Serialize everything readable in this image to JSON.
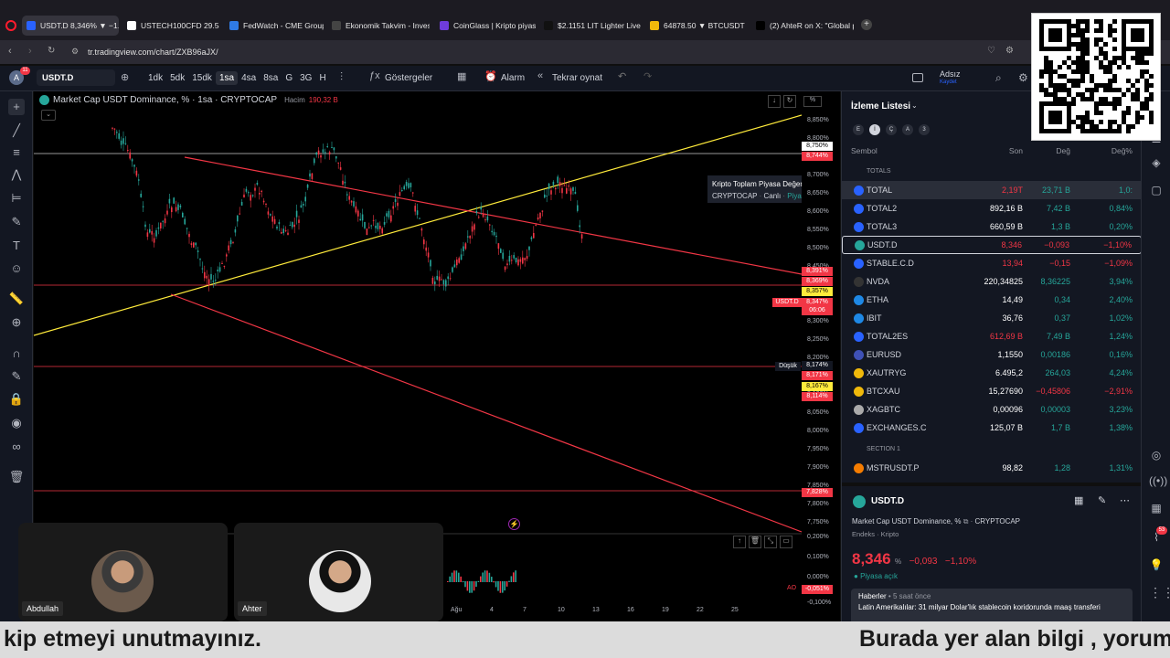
{
  "tabs": [
    {
      "label": "USDT.D 8,346% ▼ −1.1%",
      "active": true,
      "color": "#2962ff"
    },
    {
      "label": "USTECH100CFD 29.584,8",
      "color": "#fff"
    },
    {
      "label": "FedWatch - CME Group",
      "color": "#2f7be5"
    },
    {
      "label": "Ekonomik Takvim - Invest",
      "color": "#444"
    },
    {
      "label": "CoinGlass | Kripto piyasa",
      "color": "#6f3cdb"
    },
    {
      "label": "$2.1151 LIT Lighter Live P",
      "color": "#111"
    },
    {
      "label": "64878.50 ▼ BTCUSDT",
      "color": "#f0b90b"
    },
    {
      "label": "(2) AhteR on X: \"Global p",
      "color": "#000"
    }
  ],
  "address": "tr.tradingview.com/chart/ZXB96aJX/",
  "toolbar": {
    "symbol": "USDT.D",
    "avatar": "A",
    "avatar_badge": "11",
    "intervals": [
      "1dk",
      "5dk",
      "15dk",
      "1sa",
      "4sa",
      "8sa",
      "G",
      "3G",
      "H"
    ],
    "active_interval": "1sa",
    "indicators": "Göstergeler",
    "alarm": "Alarm",
    "replay": "Tekrar oynat",
    "user": "Adsız",
    "user_sub": "Kaydet"
  },
  "chart": {
    "title": "Market Cap USDT Dominance, % · 1sa · CRYPTOCAP",
    "volume_label": "Hacim",
    "volume_value": "190,32 B",
    "tooltip_title": "Kripto Toplam Piyasa Değeri, $",
    "tooltip_src": "CRYPTOCAP",
    "tooltip_state": "Canlı",
    "tooltip_open": "Piyasa açık",
    "low_label": "Düşük",
    "pct_symbol": "%",
    "ao_label": "AO",
    "time_labels": [
      "Ağu",
      "4",
      "7",
      "10",
      "13",
      "16",
      "19",
      "22",
      "25"
    ]
  },
  "price_axis": {
    "labels": [
      "8,850%",
      "8,800%",
      "8,700%",
      "8,650%",
      "8,600%",
      "8,550%",
      "8,500%",
      "8,450%",
      "8,300%",
      "8,250%",
      "8,200%",
      "8,150%",
      "8,100%",
      "8,050%",
      "8,000%",
      "7,950%",
      "7,900%",
      "7,850%",
      "7,800%",
      "7,750%",
      "0,200%",
      "0,100%",
      "0,000%",
      "-0,100%"
    ],
    "tags": [
      {
        "t": "8,750%",
        "bg": "#fff",
        "fg": "#000"
      },
      {
        "t": "8,744%",
        "bg": "#f23645",
        "fg": "#fff"
      },
      {
        "t": "8,391%",
        "bg": "#f23645",
        "fg": "#fff"
      },
      {
        "t": "8,369%",
        "bg": "#f23645",
        "fg": "#fff"
      },
      {
        "t": "8,357%",
        "bg": "#ffeb3b",
        "fg": "#000"
      },
      {
        "t": "8,347%",
        "bg": "#f23645",
        "fg": "#fff"
      },
      {
        "t": "06:06",
        "bg": "#f23645",
        "fg": "#fff"
      },
      {
        "t": "8,174%",
        "bg": "#131722",
        "fg": "#fff"
      },
      {
        "t": "8,171%",
        "bg": "#f23645",
        "fg": "#fff"
      },
      {
        "t": "8,167%",
        "bg": "#ffeb3b",
        "fg": "#000"
      },
      {
        "t": "8,114%",
        "bg": "#f23645",
        "fg": "#fff"
      },
      {
        "t": "7,828%",
        "bg": "#f23645",
        "fg": "#fff"
      },
      {
        "t": "-0,051%",
        "bg": "#f23645",
        "fg": "#fff"
      }
    ],
    "symbol_tag": "USDT.D"
  },
  "watchlist": {
    "title": "İzleme Listesi",
    "filters": [
      "E",
      "İ",
      "Ç",
      "A",
      "3"
    ],
    "col_symbol": "Sembol",
    "col_last": "Son",
    "col_chg": "Değ",
    "col_pct": "Değ%",
    "section1": "TOTALS",
    "section2": "SECTION 1",
    "rows": [
      {
        "sym": "TOTAL",
        "last": "2,19T",
        "chg": "23,71 B",
        "pct": "1,0:",
        "lc": "dn",
        "cc": "up",
        "ic": "#2962ff"
      },
      {
        "sym": "TOTAL2",
        "last": "892,16 B",
        "chg": "7,42 B",
        "pct": "0,84%",
        "lc": "wh",
        "cc": "up",
        "ic": "#2962ff"
      },
      {
        "sym": "TOTAL3",
        "last": "660,59 B",
        "chg": "1,3 B",
        "pct": "0,20%",
        "lc": "wh",
        "cc": "up",
        "ic": "#2962ff"
      },
      {
        "sym": "USDT.D",
        "last": "8,346",
        "chg": "−0,093",
        "pct": "−1,10%",
        "lc": "dn",
        "cc": "dn",
        "ic": "#26a69a"
      },
      {
        "sym": "STABLE.C.D",
        "last": "13,94",
        "chg": "−0,15",
        "pct": "−1,09%",
        "lc": "dn",
        "cc": "dn",
        "ic": "#2962ff"
      },
      {
        "sym": "NVDA",
        "last": "220,34825",
        "chg": "8,36225",
        "pct": "3,94%",
        "lc": "wh",
        "cc": "up",
        "ic": "#333"
      },
      {
        "sym": "ETHA",
        "last": "14,49",
        "chg": "0,34",
        "pct": "2,40%",
        "lc": "wh",
        "cc": "up",
        "ic": "#1e88e5"
      },
      {
        "sym": "IBIT",
        "last": "36,76",
        "chg": "0,37",
        "pct": "1,02%",
        "lc": "wh",
        "cc": "up",
        "ic": "#1e88e5"
      },
      {
        "sym": "TOTAL2ES",
        "last": "612,69 B",
        "chg": "7,49 B",
        "pct": "1,24%",
        "lc": "dn",
        "cc": "up",
        "ic": "#2962ff"
      },
      {
        "sym": "EURUSD",
        "last": "1,1550",
        "chg": "0,00186",
        "pct": "0,16%",
        "lc": "wh",
        "cc": "up",
        "ic": "#3f51b5"
      },
      {
        "sym": "XAUTRYG",
        "last": "6.495,2",
        "chg": "264,03",
        "pct": "4,24%",
        "lc": "wh",
        "cc": "up",
        "ic": "#f0b90b"
      },
      {
        "sym": "BTCXAU",
        "last": "15,27690",
        "chg": "−0,45806",
        "pct": "−2,91%",
        "lc": "wh",
        "cc": "dn",
        "ic": "#f0b90b"
      },
      {
        "sym": "XAGBTC",
        "last": "0,00096",
        "chg": "0,00003",
        "pct": "3,23%",
        "lc": "wh",
        "cc": "up",
        "ic": "#aaa"
      },
      {
        "sym": "EXCHANGES.C",
        "last": "125,07 B",
        "chg": "1,7 B",
        "pct": "1,38%",
        "lc": "wh",
        "cc": "up",
        "ic": "#2962ff"
      },
      {
        "sym": "MSTRUSDT.P",
        "last": "98,82",
        "chg": "1,28",
        "pct": "1,31%",
        "lc": "wh",
        "cc": "up",
        "ic": "#f57c00"
      }
    ],
    "detail_symbol": "USDT.D",
    "detail_name": "Market Cap USDT Dominance, %",
    "detail_src": "CRYPTOCAP",
    "detail_sub": "Endeks · Kripto",
    "detail_price": "8,346",
    "detail_unit": "%",
    "detail_chg": "−0,093",
    "detail_pct": "−1,10%",
    "detail_status": "Piyasa açık",
    "news_label": "Haberler",
    "news_time": "5 saat önce",
    "news_text": "Latin Amerikalılar: 31 milyar Dolar'lık stablecoin koridorunda maaş transferi"
  },
  "cameras": [
    {
      "name": "Abdullah"
    },
    {
      "name": "Ahter"
    }
  ],
  "ticker": {
    "left": "kip etmeyi unutmayınız.",
    "right": "Burada yer alan bilgi , yorum"
  },
  "badge_count": "53",
  "colors": {
    "up": "#26a69a",
    "down": "#f23645",
    "yellow": "#ffeb3b",
    "accent": "#2962ff"
  }
}
